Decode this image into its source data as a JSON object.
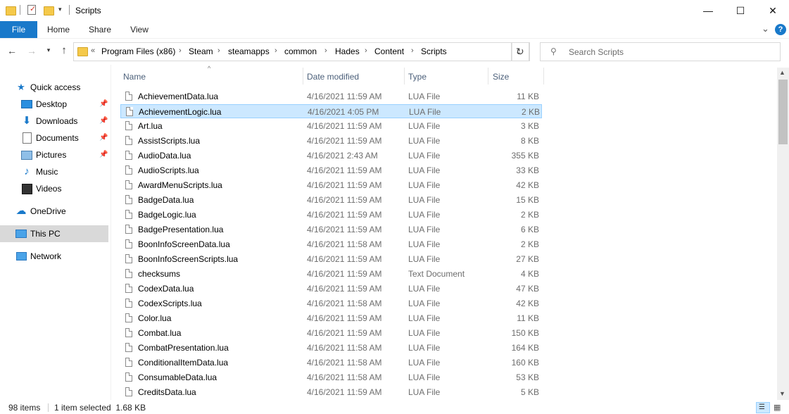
{
  "window": {
    "title": "Scripts",
    "controls": {
      "minimize": "—",
      "maximize": "☐",
      "close": "✕"
    }
  },
  "ribbon": {
    "tabs": [
      {
        "label": "File"
      },
      {
        "label": "Home"
      },
      {
        "label": "Share"
      },
      {
        "label": "View"
      }
    ],
    "help": "?",
    "expand": "⌄"
  },
  "address": {
    "overflow": "«",
    "breadcrumbs": [
      "Program Files (x86)",
      "Steam",
      "steamapps",
      "common",
      "Hades",
      "Content",
      "Scripts"
    ],
    "search_placeholder": "Search Scripts"
  },
  "nav_pane": {
    "quick_access": "Quick access",
    "pinned": [
      "Desktop",
      "Downloads",
      "Documents",
      "Pictures"
    ],
    "unpinned": [
      "Music",
      "Videos"
    ],
    "onedrive": "OneDrive",
    "this_pc": "This PC",
    "network": "Network"
  },
  "columns": {
    "name": "Name",
    "date": "Date modified",
    "type": "Type",
    "size": "Size"
  },
  "files": [
    {
      "name": "AchievementData.lua",
      "date": "4/16/2021 11:59 AM",
      "type": "LUA File",
      "size": "11 KB"
    },
    {
      "name": "AchievementLogic.lua",
      "date": "4/16/2021 4:05 PM",
      "type": "LUA File",
      "size": "2 KB"
    },
    {
      "name": "Art.lua",
      "date": "4/16/2021 11:59 AM",
      "type": "LUA File",
      "size": "3 KB"
    },
    {
      "name": "AssistScripts.lua",
      "date": "4/16/2021 11:59 AM",
      "type": "LUA File",
      "size": "8 KB"
    },
    {
      "name": "AudioData.lua",
      "date": "4/16/2021 2:43 AM",
      "type": "LUA File",
      "size": "355 KB"
    },
    {
      "name": "AudioScripts.lua",
      "date": "4/16/2021 11:59 AM",
      "type": "LUA File",
      "size": "33 KB"
    },
    {
      "name": "AwardMenuScripts.lua",
      "date": "4/16/2021 11:59 AM",
      "type": "LUA File",
      "size": "42 KB"
    },
    {
      "name": "BadgeData.lua",
      "date": "4/16/2021 11:59 AM",
      "type": "LUA File",
      "size": "15 KB"
    },
    {
      "name": "BadgeLogic.lua",
      "date": "4/16/2021 11:59 AM",
      "type": "LUA File",
      "size": "2 KB"
    },
    {
      "name": "BadgePresentation.lua",
      "date": "4/16/2021 11:59 AM",
      "type": "LUA File",
      "size": "6 KB"
    },
    {
      "name": "BoonInfoScreenData.lua",
      "date": "4/16/2021 11:58 AM",
      "type": "LUA File",
      "size": "2 KB"
    },
    {
      "name": "BoonInfoScreenScripts.lua",
      "date": "4/16/2021 11:59 AM",
      "type": "LUA File",
      "size": "27 KB"
    },
    {
      "name": "checksums",
      "date": "4/16/2021 11:59 AM",
      "type": "Text Document",
      "size": "4 KB"
    },
    {
      "name": "CodexData.lua",
      "date": "4/16/2021 11:59 AM",
      "type": "LUA File",
      "size": "47 KB"
    },
    {
      "name": "CodexScripts.lua",
      "date": "4/16/2021 11:58 AM",
      "type": "LUA File",
      "size": "42 KB"
    },
    {
      "name": "Color.lua",
      "date": "4/16/2021 11:59 AM",
      "type": "LUA File",
      "size": "11 KB"
    },
    {
      "name": "Combat.lua",
      "date": "4/16/2021 11:59 AM",
      "type": "LUA File",
      "size": "150 KB"
    },
    {
      "name": "CombatPresentation.lua",
      "date": "4/16/2021 11:58 AM",
      "type": "LUA File",
      "size": "164 KB"
    },
    {
      "name": "ConditionalItemData.lua",
      "date": "4/16/2021 11:58 AM",
      "type": "LUA File",
      "size": "160 KB"
    },
    {
      "name": "ConsumableData.lua",
      "date": "4/16/2021 11:58 AM",
      "type": "LUA File",
      "size": "53 KB"
    },
    {
      "name": "CreditsData.lua",
      "date": "4/16/2021 11:59 AM",
      "type": "LUA File",
      "size": "5 KB"
    }
  ],
  "selected_index": 1,
  "status": {
    "count": "98 items",
    "selection": "1 item selected  1.68 KB"
  },
  "colors": {
    "accent": "#1979ca",
    "selection_bg": "#cce8ff",
    "selection_border": "#99d1ff"
  }
}
